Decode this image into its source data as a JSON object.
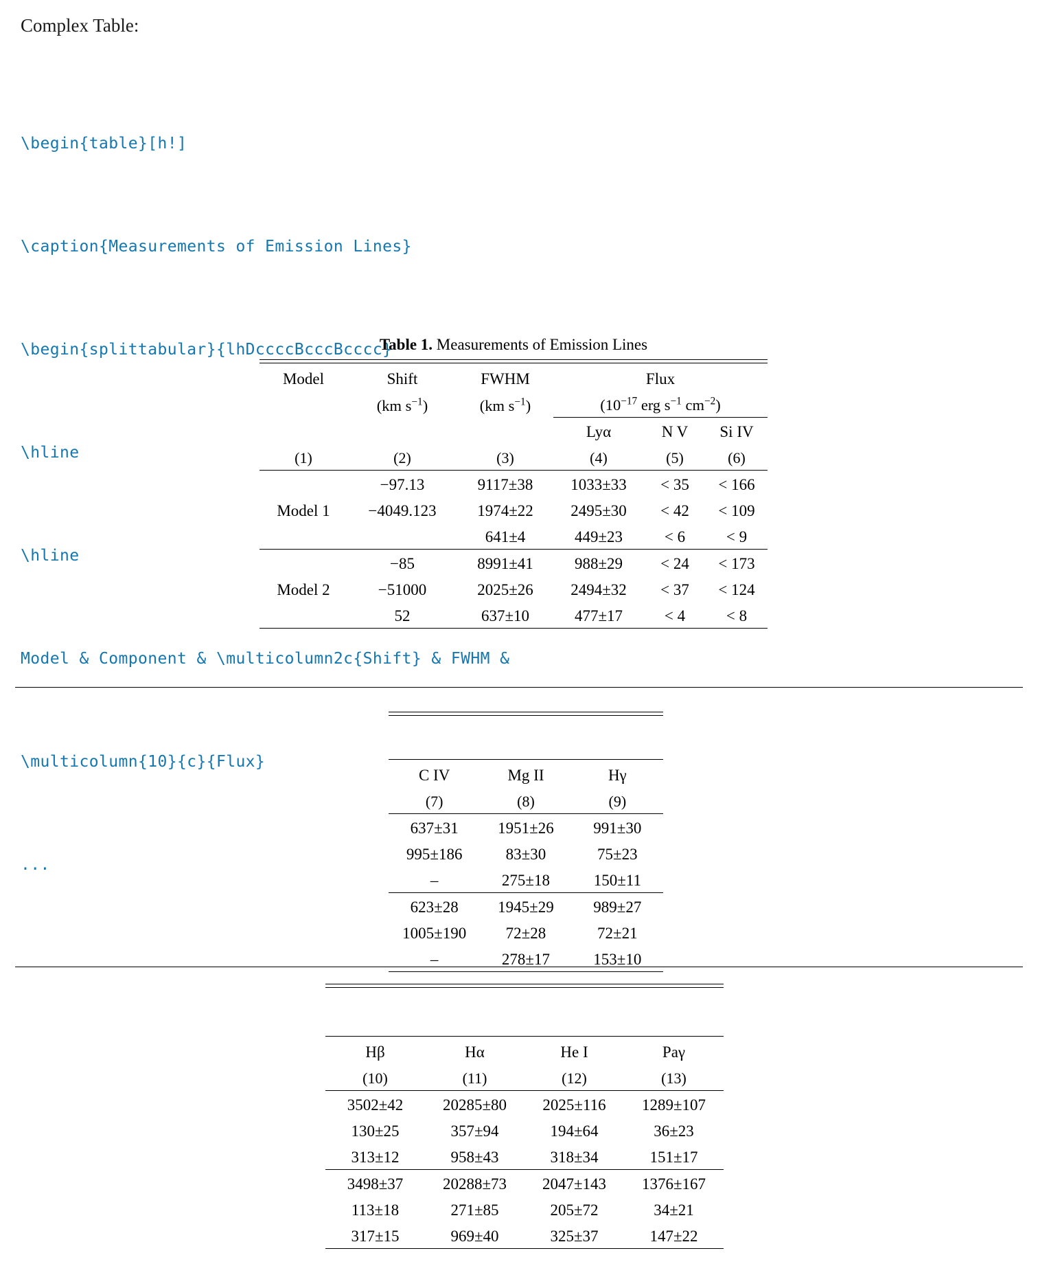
{
  "intro": {
    "title": "Complex Table:",
    "code_lines": [
      "\\begin{table}[h!]",
      "\\caption{Measurements of Emission Lines}",
      "\\begin{splittabular}{lhDccccBcccBcccc}",
      "\\hline",
      "\\hline",
      "Model & Component & \\multicolumn2c{Shift} & FWHM &",
      "\\multicolumn{10}{c}{Flux}",
      "..."
    ]
  },
  "table1": {
    "caption_label": "Table 1.",
    "caption_text": "Measurements of Emission Lines",
    "headers": {
      "model": "Model",
      "shift": "Shift",
      "fwhm": "FWHM",
      "flux": "Flux"
    },
    "units": {
      "shift": "(km s",
      "shift_exp": "−1",
      "shift_close": ")",
      "fwhm": "(km s",
      "fwhm_exp": "−1",
      "fwhm_close": ")",
      "flux_open": "(10",
      "flux_exp1": "−17",
      "flux_mid": " erg s",
      "flux_exp2": "−1",
      "flux_mid2": " cm",
      "flux_exp3": "−2",
      "flux_close": ")"
    },
    "subheaders": {
      "lya": "Lyα",
      "nv": "N V",
      "siiv": "Si IV"
    },
    "colnums": [
      "(1)",
      "(2)",
      "(3)",
      "(4)",
      "(5)",
      "(6)"
    ],
    "groups": [
      {
        "model": "Model 1",
        "model_row_index": 1,
        "rows": [
          {
            "shift": "−97.13",
            "fwhm": "9117±38",
            "lya": "1033±33",
            "nv": "< 35",
            "siiv": "< 166"
          },
          {
            "shift": "−4049.123",
            "fwhm": "1974±22",
            "lya": "2495±30",
            "nv": "< 42",
            "siiv": "< 109"
          },
          {
            "shift": "",
            "fwhm": "641±4",
            "lya": "449±23",
            "nv": "< 6",
            "siiv": "< 9"
          }
        ]
      },
      {
        "model": "Model 2",
        "model_row_index": 1,
        "rows": [
          {
            "shift": "−85",
            "fwhm": "8991±41",
            "lya": "988±29",
            "nv": "< 24",
            "siiv": "< 173"
          },
          {
            "shift": "−51000",
            "fwhm": "2025±26",
            "lya": "2494±32",
            "nv": "< 37",
            "siiv": "< 124"
          },
          {
            "shift": "52",
            "fwhm": "637±10",
            "lya": "477±17",
            "nv": "< 4",
            "siiv": "< 8"
          }
        ]
      }
    ]
  },
  "table2": {
    "headers": [
      "C IV",
      "Mg II",
      "Hγ"
    ],
    "colnums": [
      "(7)",
      "(8)",
      "(9)"
    ],
    "groups": [
      {
        "rows": [
          {
            "civ": "637±31",
            "mgii": "1951±26",
            "hgamma": "991±30"
          },
          {
            "civ": "995±186",
            "mgii": "83±30",
            "hgamma": "75±23"
          },
          {
            "civ": "–",
            "mgii": "275±18",
            "hgamma": "150±11"
          }
        ]
      },
      {
        "rows": [
          {
            "civ": "623±28",
            "mgii": "1945±29",
            "hgamma": "989±27"
          },
          {
            "civ": "1005±190",
            "mgii": "72±28",
            "hgamma": "72±21"
          },
          {
            "civ": "–",
            "mgii": "278±17",
            "hgamma": "153±10"
          }
        ]
      }
    ]
  },
  "table3": {
    "headers": [
      "Hβ",
      "Hα",
      "He I",
      "Paγ"
    ],
    "colnums": [
      "(10)",
      "(11)",
      "(12)",
      "(13)"
    ],
    "groups": [
      {
        "rows": [
          {
            "hbeta": "3502±42",
            "halpha": "20285±80",
            "hei": "2025±116",
            "pagamma": "1289±107"
          },
          {
            "hbeta": "130±25",
            "halpha": "357±94",
            "hei": "194±64",
            "pagamma": "36±23"
          },
          {
            "hbeta": "313±12",
            "halpha": "958±43",
            "hei": "318±34",
            "pagamma": "151±17"
          }
        ]
      },
      {
        "rows": [
          {
            "hbeta": "3498±37",
            "halpha": "20288±73",
            "hei": "2047±143",
            "pagamma": "1376±167"
          },
          {
            "hbeta": "113±18",
            "halpha": "271±85",
            "hei": "205±72",
            "pagamma": "34±21"
          },
          {
            "hbeta": "317±15",
            "halpha": "969±40",
            "hei": "325±37",
            "pagamma": "147±22"
          }
        ]
      }
    ]
  },
  "colors": {
    "code": "#1577b0",
    "text": "#000000",
    "background": "#ffffff"
  }
}
